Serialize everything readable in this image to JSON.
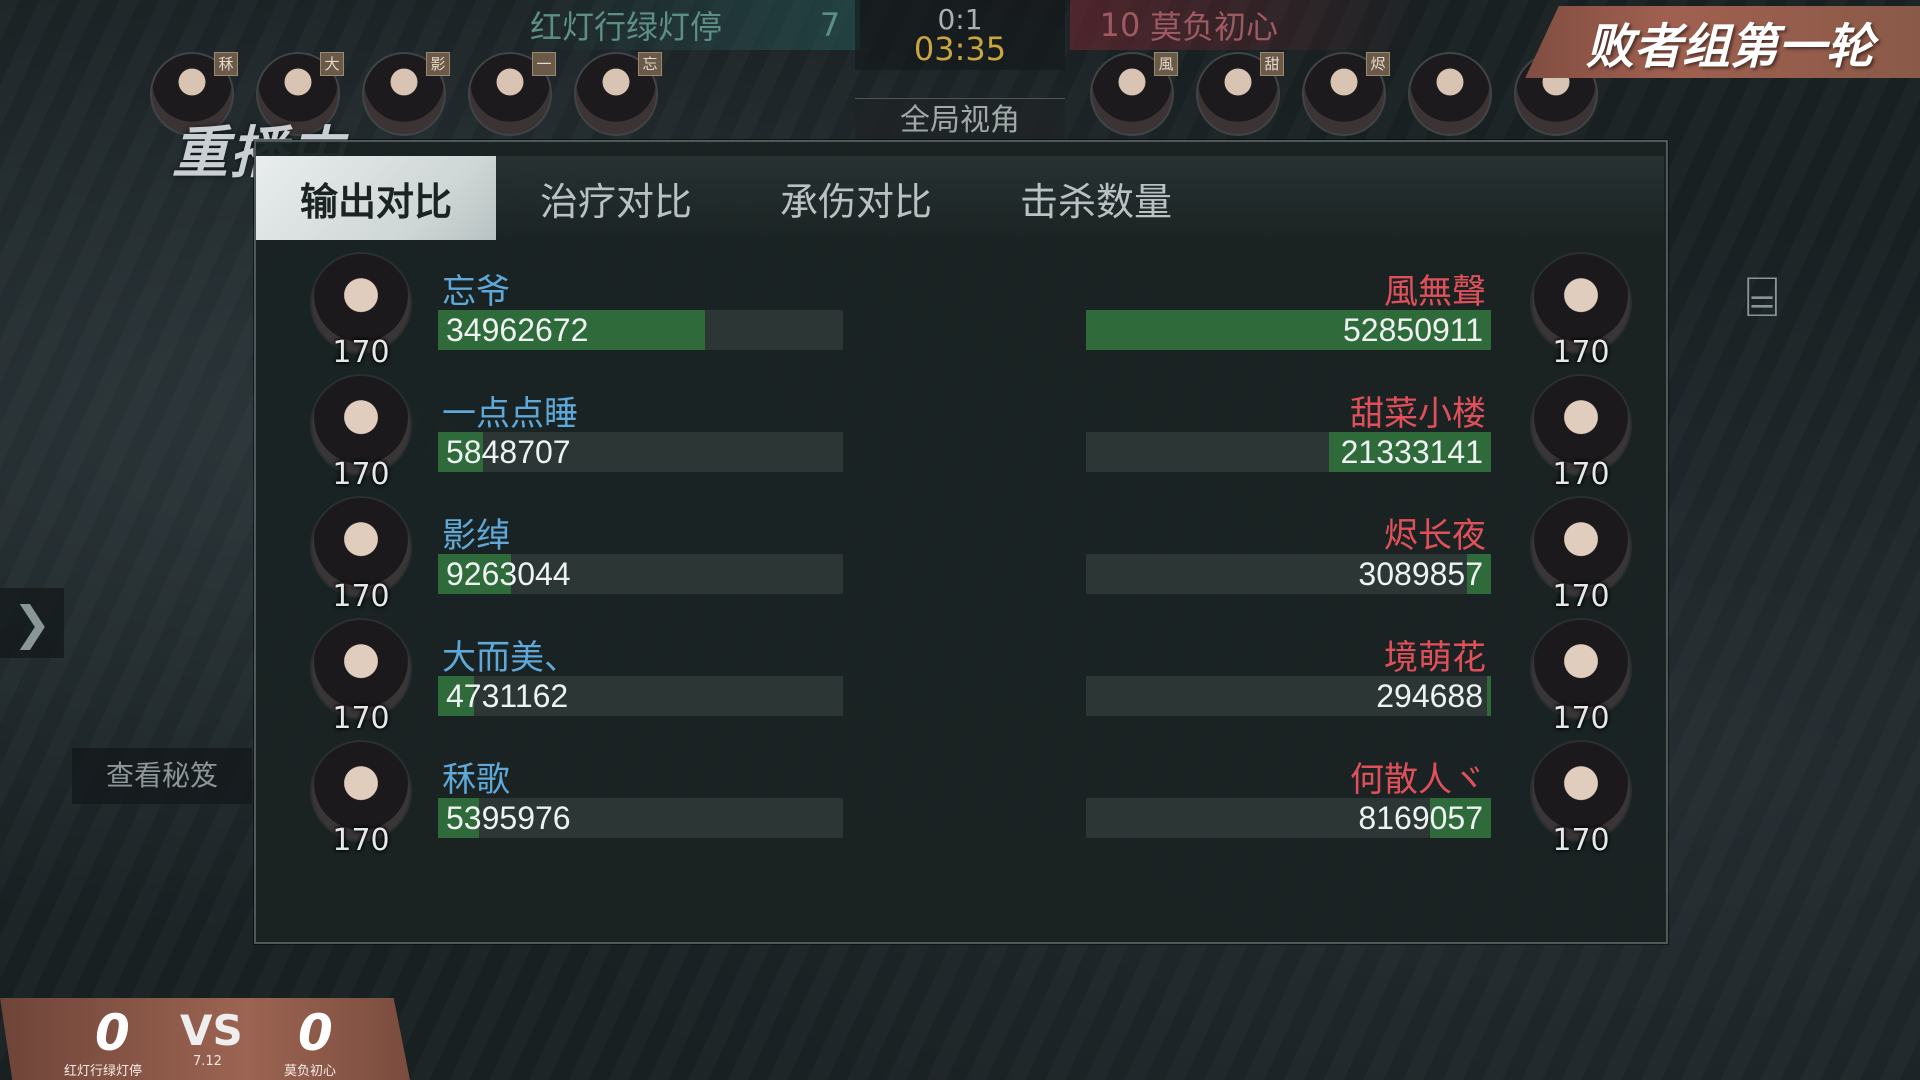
{
  "hud": {
    "left_team_name": "红灯行绿灯停",
    "left_team_kills": "7",
    "right_team_name": "莫负初心",
    "right_team_kills": "10",
    "match_score": "0:1",
    "timer": "03:35",
    "view_mode_label": "全局视角",
    "round_title": "败者组第一轮",
    "replay_label": "重播中",
    "left_row_tags": [
      "秝",
      "大",
      "影",
      "一",
      "忘"
    ],
    "right_row_tags": [
      "風",
      "甜",
      "烬",
      "",
      ""
    ]
  },
  "side": {
    "view_secrets_label": "查看秘笈"
  },
  "panel": {
    "tabs": [
      {
        "label": "输出对比",
        "active": true
      },
      {
        "label": "治疗对比",
        "active": false
      },
      {
        "label": "承伤对比",
        "active": false
      },
      {
        "label": "击杀数量",
        "active": false
      }
    ],
    "rows": [
      {
        "left": {
          "name": "忘爷",
          "level": "170",
          "value": "34962672",
          "ratio": 0.66
        },
        "right": {
          "name": "風無聲",
          "level": "170",
          "value": "52850911",
          "ratio": 1.0
        }
      },
      {
        "left": {
          "name": "一点点睡",
          "level": "170",
          "value": "5848707",
          "ratio": 0.11
        },
        "right": {
          "name": "甜菜小楼",
          "level": "170",
          "value": "21333141",
          "ratio": 0.4
        }
      },
      {
        "left": {
          "name": "影绰",
          "level": "170",
          "value": "9263044",
          "ratio": 0.18
        },
        "right": {
          "name": "烬长夜",
          "level": "170",
          "value": "3089857",
          "ratio": 0.06
        }
      },
      {
        "left": {
          "name": "大而美、",
          "level": "170",
          "value": "4731162",
          "ratio": 0.09
        },
        "right": {
          "name": "境萌花",
          "level": "170",
          "value": "294688",
          "ratio": 0.01
        }
      },
      {
        "left": {
          "name": "秝歌",
          "level": "170",
          "value": "5395976",
          "ratio": 0.1
        },
        "right": {
          "name": "何散人ヾ",
          "level": "170",
          "value": "8169057",
          "ratio": 0.15
        }
      }
    ]
  },
  "bottom_score": {
    "left_score": "0",
    "right_score": "0",
    "vs_label": "VS",
    "version": "7.12",
    "left_team": "红灯行绿灯停",
    "right_team": "莫负初心"
  },
  "colors": {
    "left_team": "#5fa8d8",
    "right_team": "#e0505a",
    "bar_fill": "#2f6a3a",
    "timer": "#c8a640"
  }
}
